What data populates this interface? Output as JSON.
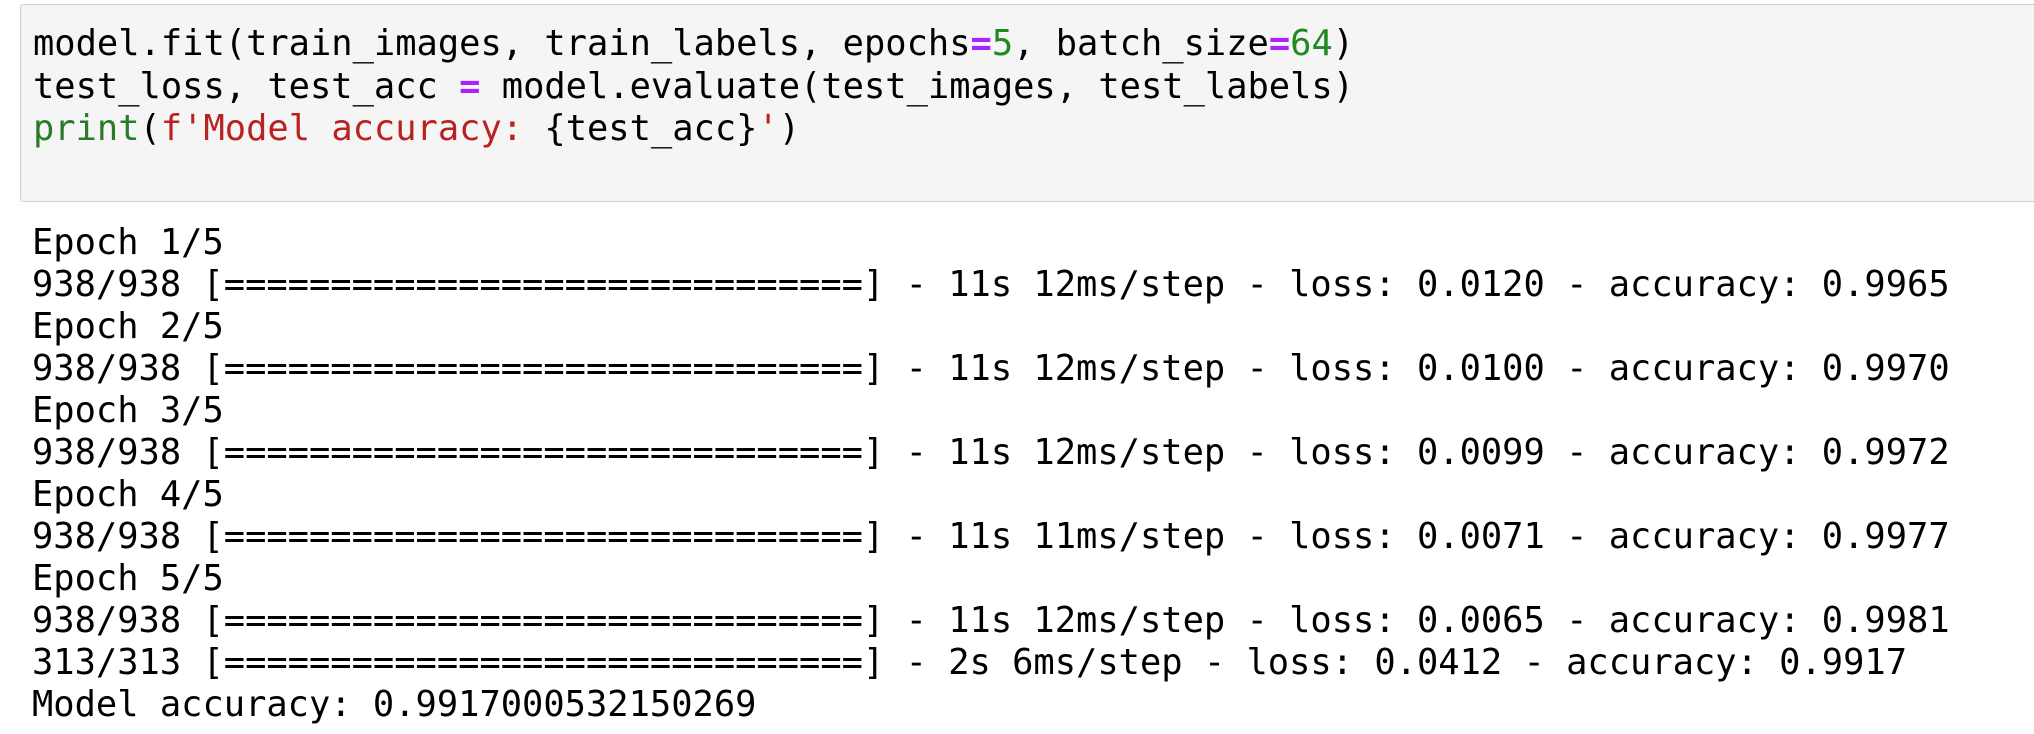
{
  "code_cell": {
    "line1": {
      "a": "model.fit(train_images, train_labels, epochs",
      "eq1": "=",
      "n1": "5",
      "b": ", batch_size",
      "eq2": "=",
      "n2": "64",
      "c": ")"
    },
    "line2": {
      "a": "test_loss, test_acc ",
      "eq": "=",
      "b": " model.evaluate(test_images, test_labels)"
    },
    "line3": {
      "builtin": "print",
      "open": "(",
      "str_start": "f'Model accuracy: ",
      "expr": "{test_acc}",
      "str_end": "'",
      "close": ")"
    }
  },
  "output_lines": [
    "Epoch 1/5",
    "938/938 [==============================] - 11s 12ms/step - loss: 0.0120 - accuracy: 0.9965",
    "Epoch 2/5",
    "938/938 [==============================] - 11s 12ms/step - loss: 0.0100 - accuracy: 0.9970",
    "Epoch 3/5",
    "938/938 [==============================] - 11s 12ms/step - loss: 0.0099 - accuracy: 0.9972",
    "Epoch 4/5",
    "938/938 [==============================] - 11s 11ms/step - loss: 0.0071 - accuracy: 0.9977",
    "Epoch 5/5",
    "938/938 [==============================] - 11s 12ms/step - loss: 0.0065 - accuracy: 0.9981",
    "313/313 [==============================] - 2s 6ms/step - loss: 0.0412 - accuracy: 0.9917",
    "Model accuracy: 0.9917000532150269"
  ],
  "colors": {
    "operator": "#aa22ff",
    "number": "#228822",
    "builtin": "#2a7a2a",
    "string": "#ba2121",
    "cell_background": "#f5f5f5",
    "cell_border": "#cfcfcf"
  }
}
